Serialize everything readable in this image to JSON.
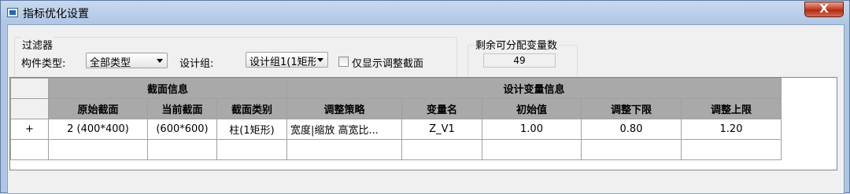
{
  "window": {
    "title": "指标优化设置",
    "close_label": "X"
  },
  "filter": {
    "group_label": "过滤器",
    "component_type_label": "构件类型:",
    "component_type_value": "全部类型",
    "design_group_label": "设计组:",
    "design_group_value": "设计组1(1矩形",
    "only_show_adjusted_label": "仅显示调整截面",
    "only_show_adjusted_checked": false
  },
  "remaining": {
    "group_label": "剩余可分配变量数",
    "value": "49"
  },
  "grid": {
    "group_headers": {
      "section_info": "截面信息",
      "design_var_info": "设计变量信息"
    },
    "columns": [
      "原始截面",
      "当前截面",
      "截面类别",
      "调整策略",
      "变量名",
      "初始值",
      "调整下限",
      "调整上限"
    ],
    "rows": [
      {
        "expand": "+",
        "original_section": "2 (400*400)",
        "current_section": "(600*600)",
        "section_type": "柱(1矩形)",
        "strategy": "宽度|缩放 高宽比...",
        "var_name": "Z_V1",
        "initial": "1.00",
        "lower": "0.80",
        "upper": "1.20"
      }
    ]
  }
}
